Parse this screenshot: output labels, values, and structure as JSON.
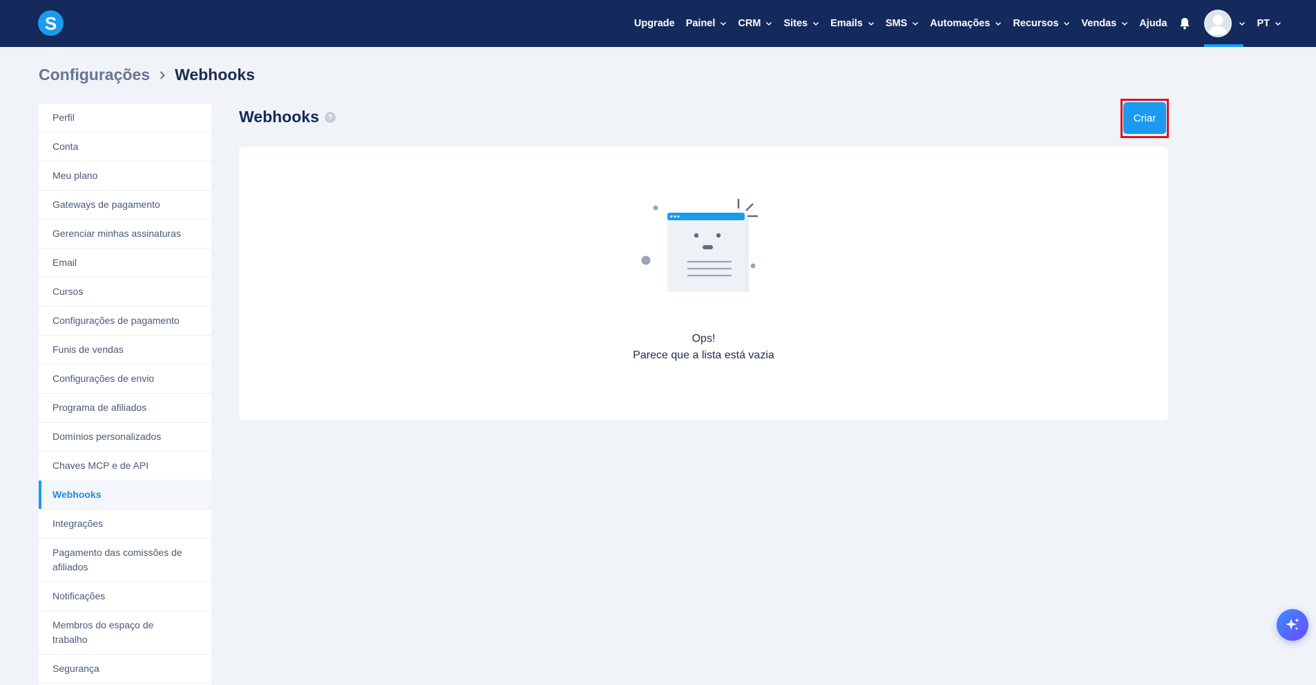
{
  "app": {
    "logo_letter": "S",
    "accent_color": "#1a9bf0",
    "nav_bg_color": "#14295c"
  },
  "nav": {
    "items": [
      {
        "label": "Upgrade",
        "has_dropdown": false
      },
      {
        "label": "Painel",
        "has_dropdown": true
      },
      {
        "label": "CRM",
        "has_dropdown": true
      },
      {
        "label": "Sites",
        "has_dropdown": true
      },
      {
        "label": "Emails",
        "has_dropdown": true
      },
      {
        "label": "SMS",
        "has_dropdown": true
      },
      {
        "label": "Automações",
        "has_dropdown": true
      },
      {
        "label": "Recursos",
        "has_dropdown": true
      },
      {
        "label": "Vendas",
        "has_dropdown": true
      },
      {
        "label": "Ajuda",
        "has_dropdown": false
      }
    ],
    "notification_icon": "bell-icon",
    "avatar_icon": "user-avatar",
    "language": "PT"
  },
  "breadcrumb": {
    "root": "Configurações",
    "current": "Webhooks"
  },
  "sidebar": {
    "items": [
      {
        "label": "Perfil"
      },
      {
        "label": "Conta"
      },
      {
        "label": "Meu plano"
      },
      {
        "label": "Gateways de pagamento"
      },
      {
        "label": "Gerenciar minhas assinaturas"
      },
      {
        "label": "Email"
      },
      {
        "label": "Cursos"
      },
      {
        "label": "Configurações de pagamento"
      },
      {
        "label": "Funis de vendas"
      },
      {
        "label": "Configurações de envio"
      },
      {
        "label": "Programa de afiliados"
      },
      {
        "label": "Domínios personalizados"
      },
      {
        "label": "Chaves MCP e de API"
      },
      {
        "label": "Webhooks",
        "active": true
      },
      {
        "label": "Integrações"
      },
      {
        "label": "Pagamento das comissões de afiliados"
      },
      {
        "label": "Notificações"
      },
      {
        "label": "Membros do espaço de trabalho"
      },
      {
        "label": "Segurança"
      }
    ]
  },
  "main": {
    "title": "Webhooks",
    "help_icon": "question-mark-icon",
    "create_button": "Criar",
    "empty_state": {
      "title": "Ops!",
      "subtitle": "Parece que a lista está vazia"
    }
  },
  "fab": {
    "icon": "sparkles-icon"
  }
}
